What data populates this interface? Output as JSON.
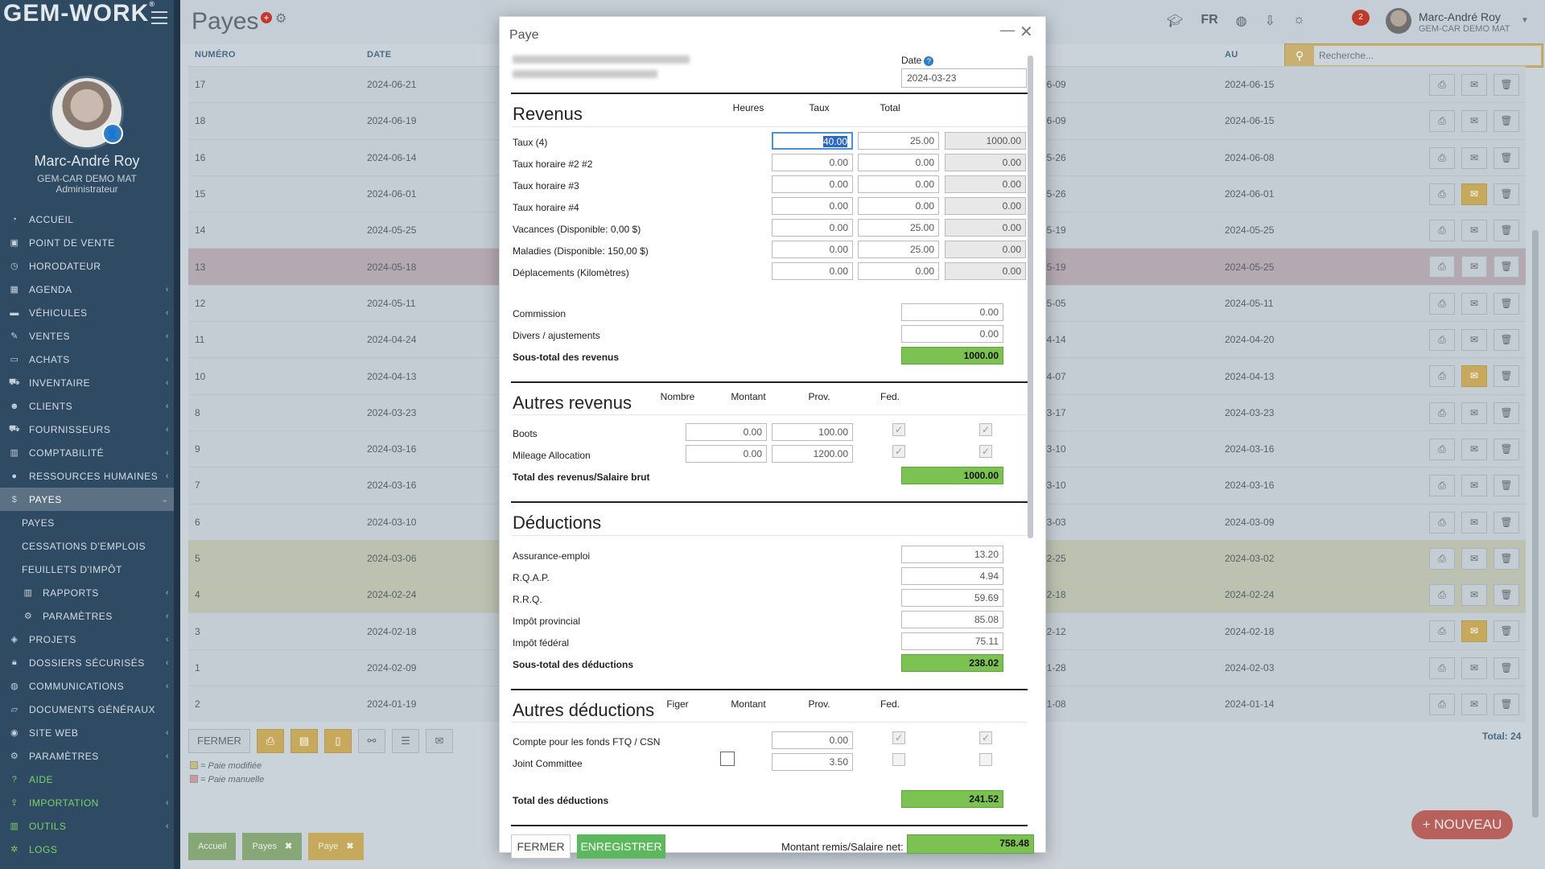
{
  "app": {
    "logo": "GEM-WORK",
    "logo_mark": "®",
    "page_title": "Payes"
  },
  "user": {
    "name": "Marc-André Roy",
    "company": "GEM-CAR DEMO MAT",
    "role": "Administrateur"
  },
  "topbar": {
    "language": "FR",
    "notifications": "2",
    "user_name": "Marc-André Roy",
    "user_company": "GEM-CAR DEMO MAT"
  },
  "search": {
    "placeholder": "Recherche..."
  },
  "sidebar": {
    "items": [
      {
        "label": "ACCUEIL",
        "icon": "dashboard-icon"
      },
      {
        "label": "POINT DE VENTE",
        "icon": "cash-register-icon"
      },
      {
        "label": "HORODATEUR",
        "icon": "clock-icon"
      },
      {
        "label": "AGENDA",
        "icon": "calendar-icon"
      },
      {
        "label": "VÉHICULES",
        "icon": "car-icon"
      },
      {
        "label": "VENTES",
        "icon": "edit-icon"
      },
      {
        "label": "ACHATS",
        "icon": "credit-card-icon"
      },
      {
        "label": "INVENTAIRE",
        "icon": "cart-icon"
      },
      {
        "label": "CLIENTS",
        "icon": "users-icon"
      },
      {
        "label": "FOURNISSEURS",
        "icon": "truck-icon"
      },
      {
        "label": "COMPTABILITÉ",
        "icon": "bar-chart-icon"
      },
      {
        "label": "RESSOURCES HUMAINES",
        "icon": "person-icon"
      },
      {
        "label": "PAYES",
        "icon": "dollar-icon"
      },
      {
        "label": "PAYES",
        "icon": ""
      },
      {
        "label": "CESSATIONS D'EMPLOIS",
        "icon": ""
      },
      {
        "label": "FEUILLETS D'IMPÔT",
        "icon": ""
      },
      {
        "label": "RAPPORTS",
        "icon": "bar-chart-icon"
      },
      {
        "label": "PARAMÈTRES",
        "icon": "gear-icon"
      },
      {
        "label": "PROJETS",
        "icon": "layers-icon"
      },
      {
        "label": "DOSSIERS SÉCURISÉS",
        "icon": "lock-icon"
      },
      {
        "label": "COMMUNICATIONS",
        "icon": "chat-icon"
      },
      {
        "label": "DOCUMENTS GÉNÉRAUX",
        "icon": "folder-icon"
      },
      {
        "label": "SITE WEB",
        "icon": "globe-icon"
      },
      {
        "label": "PARAMÈTRES",
        "icon": "gears-icon"
      },
      {
        "label": "AIDE",
        "icon": "question-icon"
      },
      {
        "label": "IMPORTATION",
        "icon": "upload-icon"
      },
      {
        "label": "OUTILS",
        "icon": "bar-chart-icon"
      },
      {
        "label": "LOGS",
        "icon": "bug-icon"
      }
    ]
  },
  "table": {
    "headers": {
      "numero": "NUMÉRO",
      "date": "DATE",
      "au": "AU"
    },
    "rows": [
      {
        "num": "17",
        "date": "2024-06-21",
        "du": "06-09",
        "au": "2024-06-15"
      },
      {
        "num": "18",
        "date": "2024-06-19",
        "du": "06-09",
        "au": "2024-06-15"
      },
      {
        "num": "16",
        "date": "2024-06-14",
        "du": "05-26",
        "au": "2024-06-08"
      },
      {
        "num": "15",
        "date": "2024-06-01",
        "du": "05-26",
        "au": "2024-06-01"
      },
      {
        "num": "14",
        "date": "2024-05-25",
        "du": "05-19",
        "au": "2024-05-25"
      },
      {
        "num": "13",
        "date": "2024-05-18",
        "du": "05-19",
        "au": "2024-05-25"
      },
      {
        "num": "12",
        "date": "2024-05-11",
        "du": "05-05",
        "au": "2024-05-11"
      },
      {
        "num": "11",
        "date": "2024-04-24",
        "du": "04-14",
        "au": "2024-04-20"
      },
      {
        "num": "10",
        "date": "2024-04-13",
        "du": "04-07",
        "au": "2024-04-13"
      },
      {
        "num": "8",
        "date": "2024-03-23",
        "du": "03-17",
        "au": "2024-03-23"
      },
      {
        "num": "9",
        "date": "2024-03-16",
        "du": "03-10",
        "au": "2024-03-16"
      },
      {
        "num": "7",
        "date": "2024-03-16",
        "du": "03-10",
        "au": "2024-03-16"
      },
      {
        "num": "6",
        "date": "2024-03-10",
        "du": "03-03",
        "au": "2024-03-09"
      },
      {
        "num": "5",
        "date": "2024-03-06",
        "du": "02-25",
        "au": "2024-03-02"
      },
      {
        "num": "4",
        "date": "2024-02-24",
        "du": "02-18",
        "au": "2024-02-24"
      },
      {
        "num": "3",
        "date": "2024-02-18",
        "du": "02-12",
        "au": "2024-02-18"
      },
      {
        "num": "1",
        "date": "2024-02-09",
        "du": "01-28",
        "au": "2024-02-03"
      },
      {
        "num": "2",
        "date": "2024-01-19",
        "du": "01-08",
        "au": "2024-01-14"
      }
    ],
    "total": "Total: 24"
  },
  "bottom": {
    "fermer": "FERMER",
    "legend_modified": "= Paie modifiée",
    "legend_manual": "= Paie manuelle"
  },
  "fab": {
    "label": "+ NOUVEAU"
  },
  "tabs": [
    {
      "label": "Accueil"
    },
    {
      "label": "Payes"
    },
    {
      "label": "Paye"
    }
  ],
  "modal": {
    "title": "Paye",
    "date_label": "Date",
    "date_value": "2024-03-23",
    "revenus": {
      "title": "Revenus",
      "cols": {
        "heures": "Heures",
        "taux": "Taux",
        "total": "Total"
      },
      "rows": [
        {
          "label": "Taux (4)",
          "heures": "40.00",
          "taux": "25.00",
          "total": "1000.00"
        },
        {
          "label": "Taux horaire #2 #2",
          "heures": "0.00",
          "taux": "0.00",
          "total": "0.00"
        },
        {
          "label": "Taux horaire #3",
          "heures": "0.00",
          "taux": "0.00",
          "total": "0.00"
        },
        {
          "label": "Taux horaire #4",
          "heures": "0.00",
          "taux": "0.00",
          "total": "0.00"
        },
        {
          "label": "Vacances (Disponible: 0,00 $)",
          "heures": "0.00",
          "taux": "25.00",
          "total": "0.00"
        },
        {
          "label": "Maladies (Disponible: 150,00 $)",
          "heures": "0.00",
          "taux": "25.00",
          "total": "0.00"
        },
        {
          "label": "Déplacements (Kilomètres)",
          "heures": "0.00",
          "taux": "0.00",
          "total": "0.00"
        }
      ],
      "commission_label": "Commission",
      "commission": "0.00",
      "divers_label": "Divers / ajustements",
      "divers": "0.00",
      "subtotal_label": "Sous-total des revenus",
      "subtotal": "1000.00"
    },
    "autres_revenus": {
      "title": "Autres revenus",
      "cols": {
        "nombre": "Nombre",
        "montant": "Montant",
        "prov": "Prov.",
        "fed": "Fed."
      },
      "rows": [
        {
          "label": "Boots",
          "nombre": "0.00",
          "montant": "100.00"
        },
        {
          "label": "Mileage Allocation",
          "nombre": "0.00",
          "montant": "1200.00"
        }
      ],
      "total_label": "Total des revenus/Salaire brut",
      "total": "1000.00"
    },
    "deductions": {
      "title": "Déductions",
      "rows": [
        {
          "label": "Assurance-emploi",
          "value": "13.20"
        },
        {
          "label": "R.Q.A.P.",
          "value": "4.94"
        },
        {
          "label": "R.R.Q.",
          "value": "59.69"
        },
        {
          "label": "Impôt provincial",
          "value": "85.08"
        },
        {
          "label": "Impôt fédéral",
          "value": "75.11"
        }
      ],
      "subtotal_label": "Sous-total des déductions",
      "subtotal": "238.02"
    },
    "autres_deductions": {
      "title": "Autres déductions",
      "cols": {
        "figer": "Figer",
        "montant": "Montant",
        "prov": "Prov.",
        "fed": "Fed."
      },
      "rows": [
        {
          "label": "Compte pour les fonds FTQ / CSN",
          "montant": "0.00"
        },
        {
          "label": "Joint Committee",
          "montant": "3.50"
        }
      ],
      "total_label": "Total des déductions",
      "total": "241.52"
    },
    "footer": {
      "fermer": "FERMER",
      "enregistrer": "ENREGISTRER",
      "net_label": "Montant remis/Salaire net:",
      "net": "758.48"
    }
  }
}
